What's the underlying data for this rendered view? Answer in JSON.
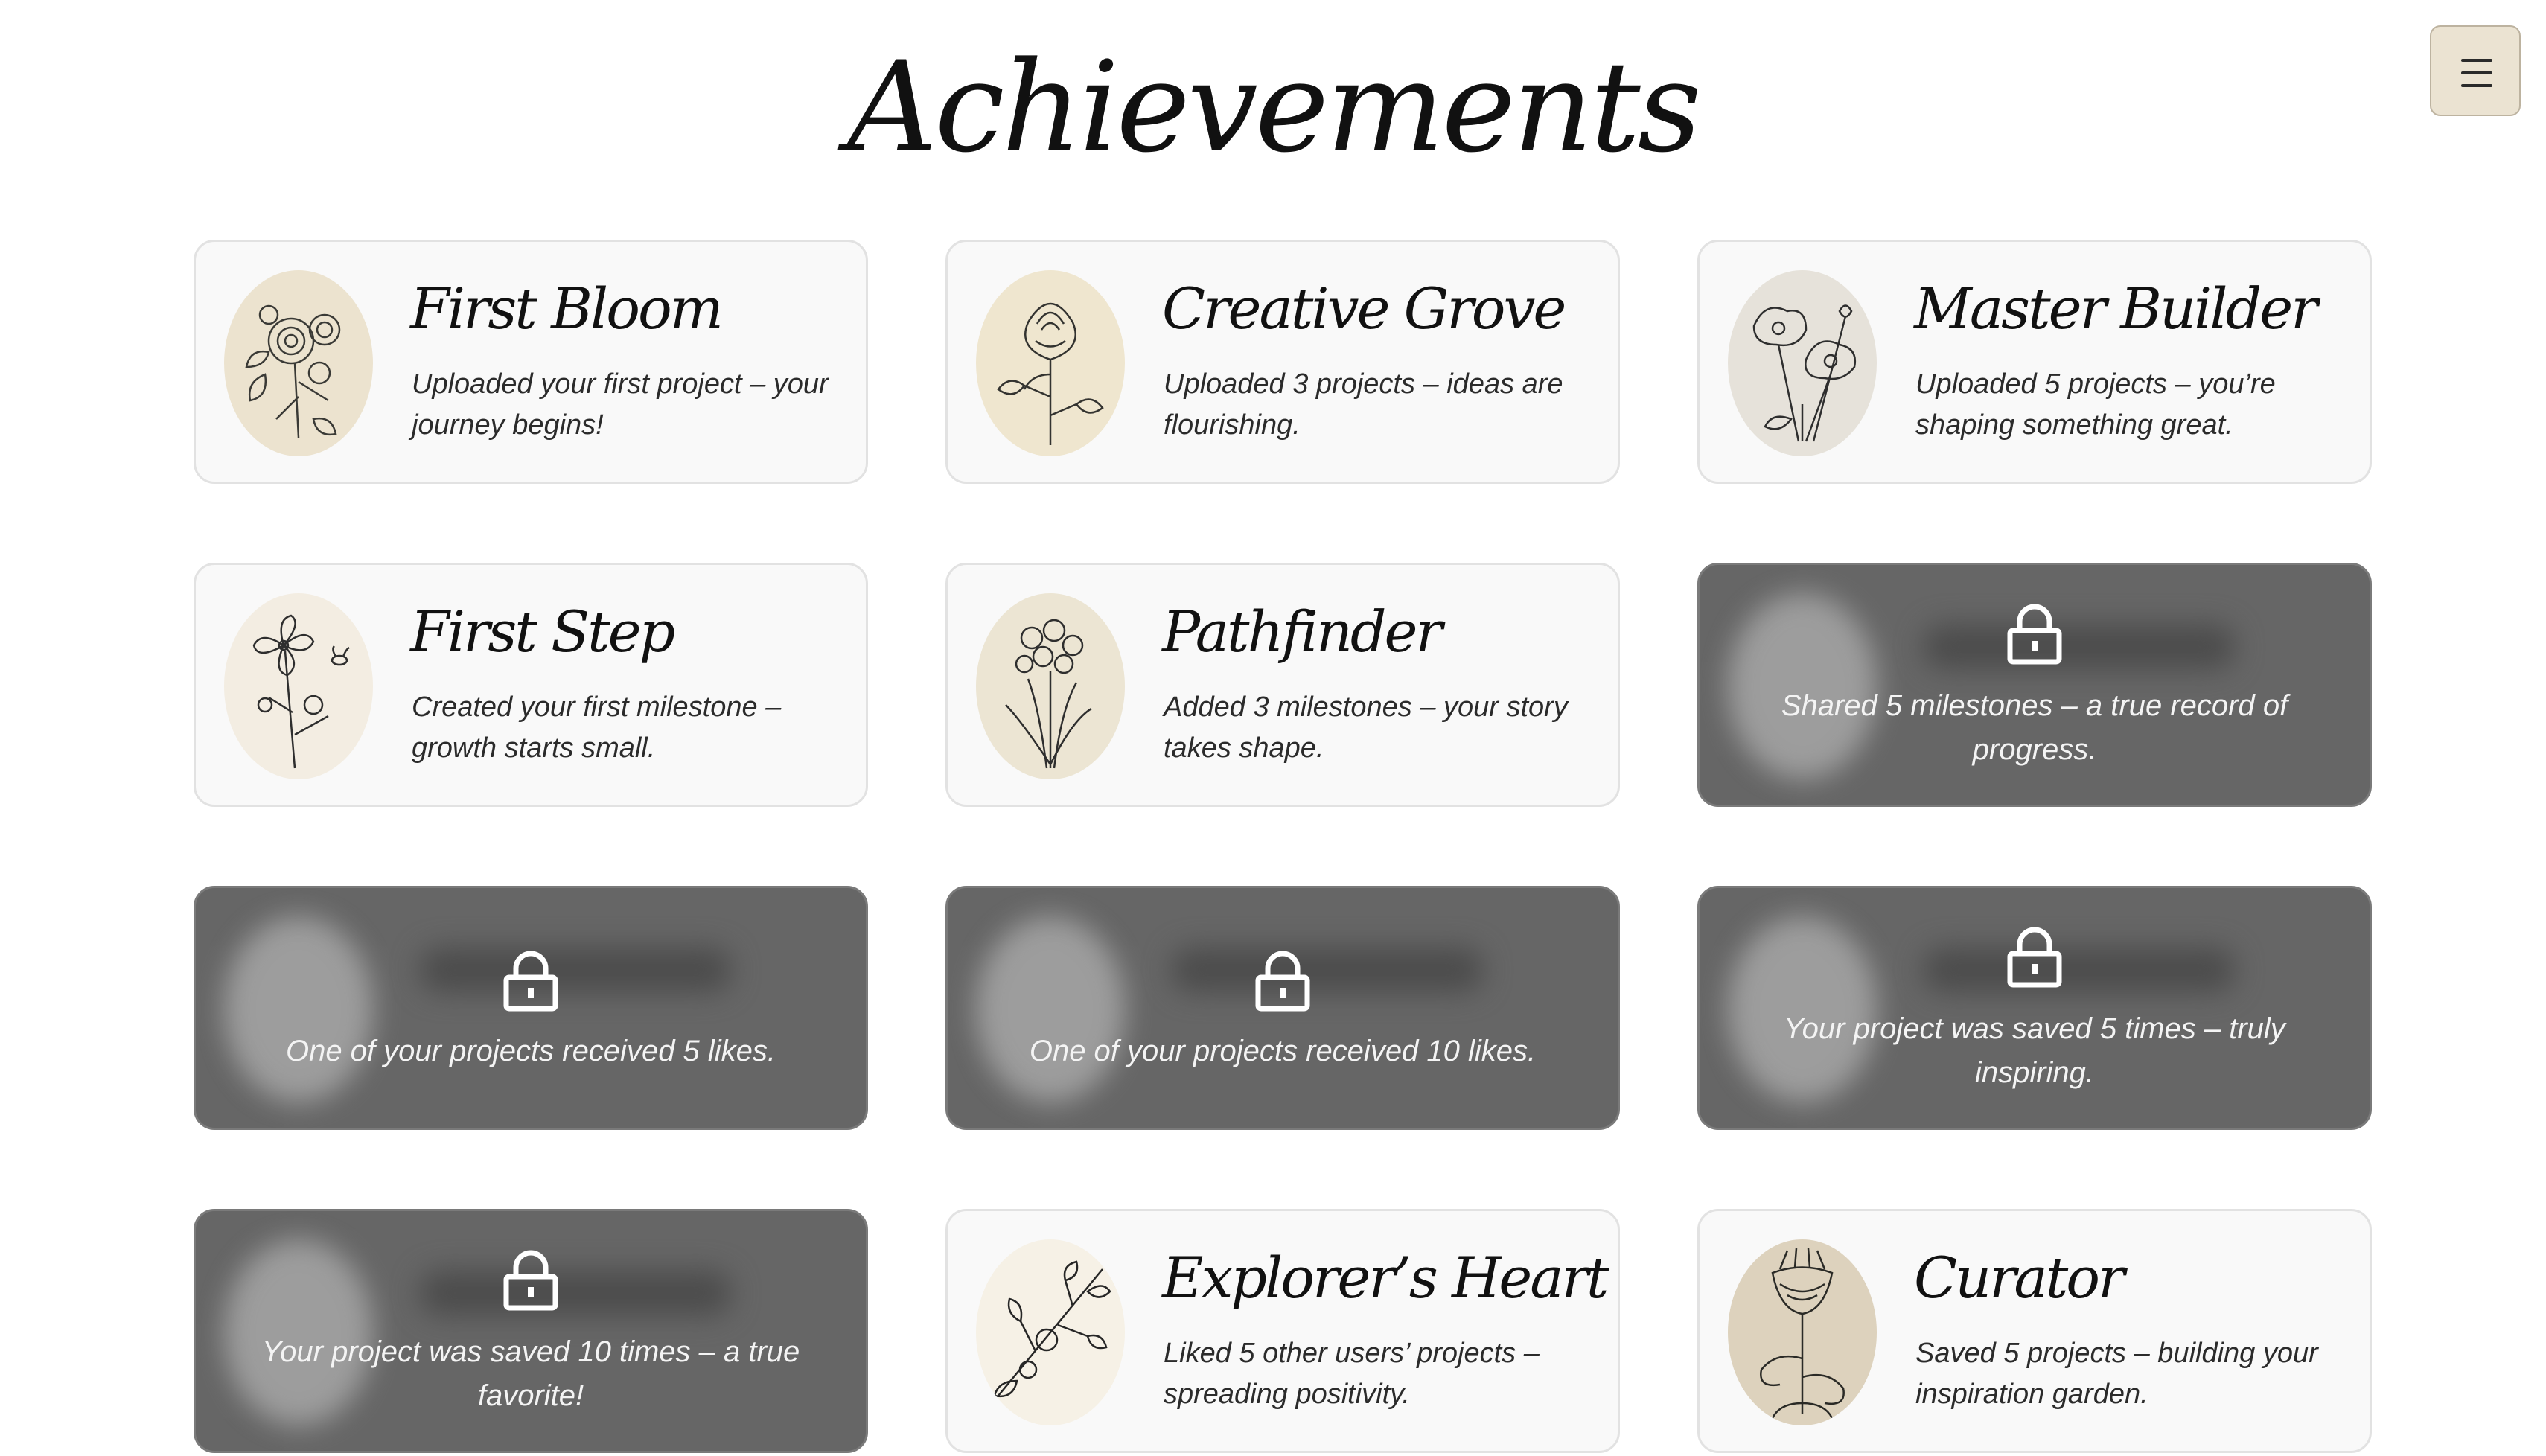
{
  "page": {
    "title": "Achievements"
  },
  "menu": {
    "icon": "hamburger-menu-icon"
  },
  "colors": {
    "card_bg": "#f9f9f9",
    "locked_bg": "#666666",
    "medallion": "#ece3cf",
    "menu_bg": "#ebe3d2"
  },
  "achievements": [
    {
      "title": "First Bloom",
      "description": "Uploaded your first project – your journey begins!",
      "locked": false,
      "icon": "rose-bouquet-illustration"
    },
    {
      "title": "Creative Grove",
      "description": "Uploaded 3 projects – ideas are flourishing.",
      "locked": false,
      "icon": "rose-illustration"
    },
    {
      "title": "Master Builder",
      "description": "Uploaded 5 projects – you’re shaping something great.",
      "locked": false,
      "icon": "poppy-illustration"
    },
    {
      "title": "First Step",
      "description": "Created your first milestone – growth starts small.",
      "locked": false,
      "icon": "wildflower-bee-illustration"
    },
    {
      "title": "Pathfinder",
      "description": "Added 3 milestones – your story takes shape.",
      "locked": false,
      "icon": "narcissus-illustration"
    },
    {
      "title": "",
      "description": "Shared 5 milestones – a true record of progress.",
      "locked": true,
      "icon": "lock-icon"
    },
    {
      "title": "",
      "description": "One of your projects received 5 likes.",
      "locked": true,
      "icon": "lock-icon"
    },
    {
      "title": "",
      "description": "One of your projects received 10 likes.",
      "locked": true,
      "icon": "lock-icon"
    },
    {
      "title": "",
      "description": "Your project was saved 5 times – truly inspiring.",
      "locked": true,
      "icon": "lock-icon"
    },
    {
      "title": "",
      "description": "Your project was saved 10 times – a true favorite!",
      "locked": true,
      "icon": "lock-icon"
    },
    {
      "title": "Explorer’s Heart",
      "description": "Liked 5 other users’ projects – spreading positivity.",
      "locked": false,
      "icon": "leafy-sprig-illustration"
    },
    {
      "title": "Curator",
      "description": "Saved 5 projects – building your inspiration garden.",
      "locked": false,
      "icon": "crown-imperial-illustration"
    }
  ]
}
